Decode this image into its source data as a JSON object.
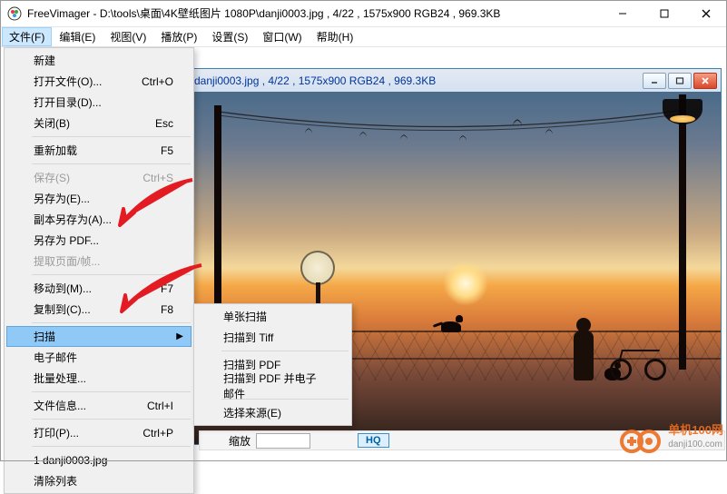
{
  "app": {
    "name": "FreeVimager",
    "title_path": "D:\\tools\\桌面\\4K壁纸图片 1080P\\danji0003.jpg , 4/22 , 1575x900 RGB24 , 969.3KB"
  },
  "menubar": {
    "items": [
      {
        "label": "文件(F)",
        "open": true
      },
      {
        "label": "编辑(E)"
      },
      {
        "label": "视图(V)"
      },
      {
        "label": "播放(P)"
      },
      {
        "label": "设置(S)"
      },
      {
        "label": "窗口(W)"
      },
      {
        "label": "帮助(H)"
      }
    ]
  },
  "file_menu": [
    {
      "label": "新建"
    },
    {
      "label": "打开文件(O)...",
      "shortcut": "Ctrl+O"
    },
    {
      "label": "打开目录(D)..."
    },
    {
      "label": "关闭(B)",
      "shortcut": "Esc"
    },
    {
      "sep": true
    },
    {
      "label": "重新加载",
      "shortcut": "F5"
    },
    {
      "sep": true
    },
    {
      "label": "保存(S)",
      "shortcut": "Ctrl+S",
      "disabled": true
    },
    {
      "label": "另存为(E)..."
    },
    {
      "label": "副本另存为(A)..."
    },
    {
      "label": "另存为 PDF..."
    },
    {
      "label": "提取页面/帧...",
      "disabled": true
    },
    {
      "sep": true
    },
    {
      "label": "移动到(M)...",
      "shortcut": "F7"
    },
    {
      "label": "复制到(C)...",
      "shortcut": "F8"
    },
    {
      "sep": true
    },
    {
      "label": "扫描",
      "submenu": true,
      "highlighted": true
    },
    {
      "label": "电子邮件"
    },
    {
      "label": "批量处理..."
    },
    {
      "sep": true
    },
    {
      "label": "文件信息...",
      "shortcut": "Ctrl+I"
    },
    {
      "sep": true
    },
    {
      "label": "打印(P)...",
      "shortcut": "Ctrl+P"
    },
    {
      "sep": true
    },
    {
      "label": "1 danji0003.jpg"
    },
    {
      "label": "清除列表"
    }
  ],
  "scan_submenu": [
    {
      "label": "单张扫描"
    },
    {
      "label": "扫描到 Tiff"
    },
    {
      "sep": true
    },
    {
      "label": "扫描到 PDF"
    },
    {
      "label": "扫描到 PDF 并电子邮件"
    },
    {
      "sep": true
    },
    {
      "label": "选择来源(E)"
    }
  ],
  "child_window": {
    "title": "danji0003.jpg , 4/22 , 1575x900 RGB24 , 969.3KB"
  },
  "toolbar": {
    "hq_label": "HQ",
    "zoom_field": "缩放"
  },
  "watermark": {
    "top": "单机100网",
    "bottom": "danji100.com"
  }
}
